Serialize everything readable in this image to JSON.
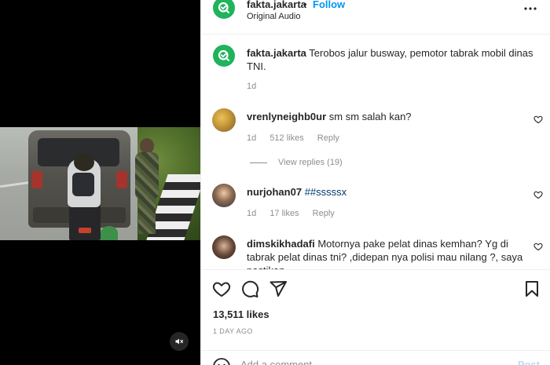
{
  "header": {
    "username": "fakta.jakarta",
    "separator": "•",
    "follow_label": "Follow",
    "audio": "Original Audio"
  },
  "caption": {
    "username": "fakta.jakarta",
    "text": "Terobos jalur busway, pemotor tabrak mobil dinas TNI.",
    "time": "1d"
  },
  "comments": [
    {
      "username": "vrenlyneighb0ur",
      "text": "sm sm salah kan?",
      "time": "1d",
      "likes": "512 likes",
      "reply_label": "Reply",
      "view_replies": "View replies (19)"
    },
    {
      "username": "nurjohan07",
      "text": "##sssssx",
      "time": "1d",
      "likes": "17 likes",
      "reply_label": "Reply"
    },
    {
      "username": "dimskikhadafi",
      "text": "Motornya pake pelat dinas kemhan? Yg di tabrak pelat dinas tni? ,didepan nya polisi mau nilang ?, saya pastikan"
    }
  ],
  "post": {
    "likes": "13,511 likes",
    "date": "1 DAY AGO"
  },
  "add_comment": {
    "placeholder": "Add a comment...",
    "post_label": "Post"
  },
  "colors": {
    "accent": "#0095f6",
    "brand_green": "#1fb35a",
    "muted": "#8e8e8e"
  }
}
